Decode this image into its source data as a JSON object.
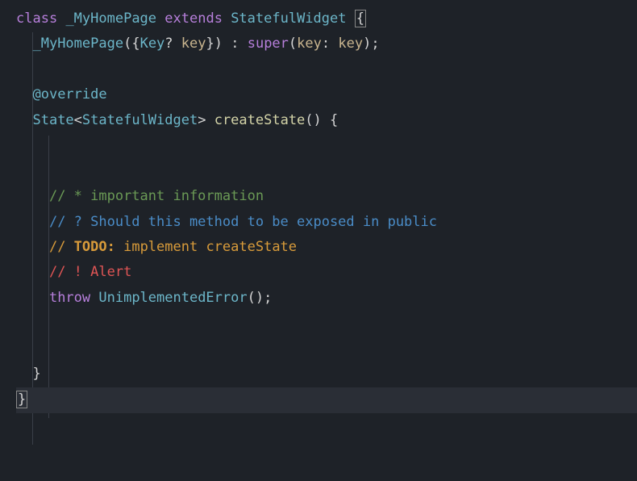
{
  "code": {
    "line1": {
      "class_kw": "class",
      "class_name": "_MyHomePage",
      "extends_kw": "extends",
      "parent_class": "StatefulWidget",
      "brace": "{"
    },
    "line2": {
      "constructor": "_MyHomePage",
      "open_paren": "(",
      "open_brace": "{",
      "key_type": "Key",
      "nullable": "?",
      "key_param": " key",
      "close_brace": "}",
      "close_paren": ")",
      "colon": " : ",
      "super_kw": "super",
      "super_open": "(",
      "named_param": "key",
      "named_colon": ": ",
      "named_val": "key",
      "super_close": ");"
    },
    "line3": {
      "annotation": "@override"
    },
    "line4": {
      "return_type": "State",
      "generic_open": "<",
      "generic_type": "StatefulWidget",
      "generic_close": ">",
      "method_name": " createState",
      "parens": "()",
      "brace": " {"
    },
    "line5": {
      "comment": "// * important information"
    },
    "line6": {
      "comment": "// ? Should this method to be exposed in public"
    },
    "line7": {
      "slash": "// ",
      "todo": "TODO:",
      "rest": " implement createState"
    },
    "line8": {
      "comment": "// ! Alert"
    },
    "line9": {
      "throw_kw": "throw",
      "error_class": " UnimplementedError",
      "parens": "();"
    },
    "line10": {
      "brace": "}"
    },
    "line11": {
      "brace": "}"
    }
  }
}
